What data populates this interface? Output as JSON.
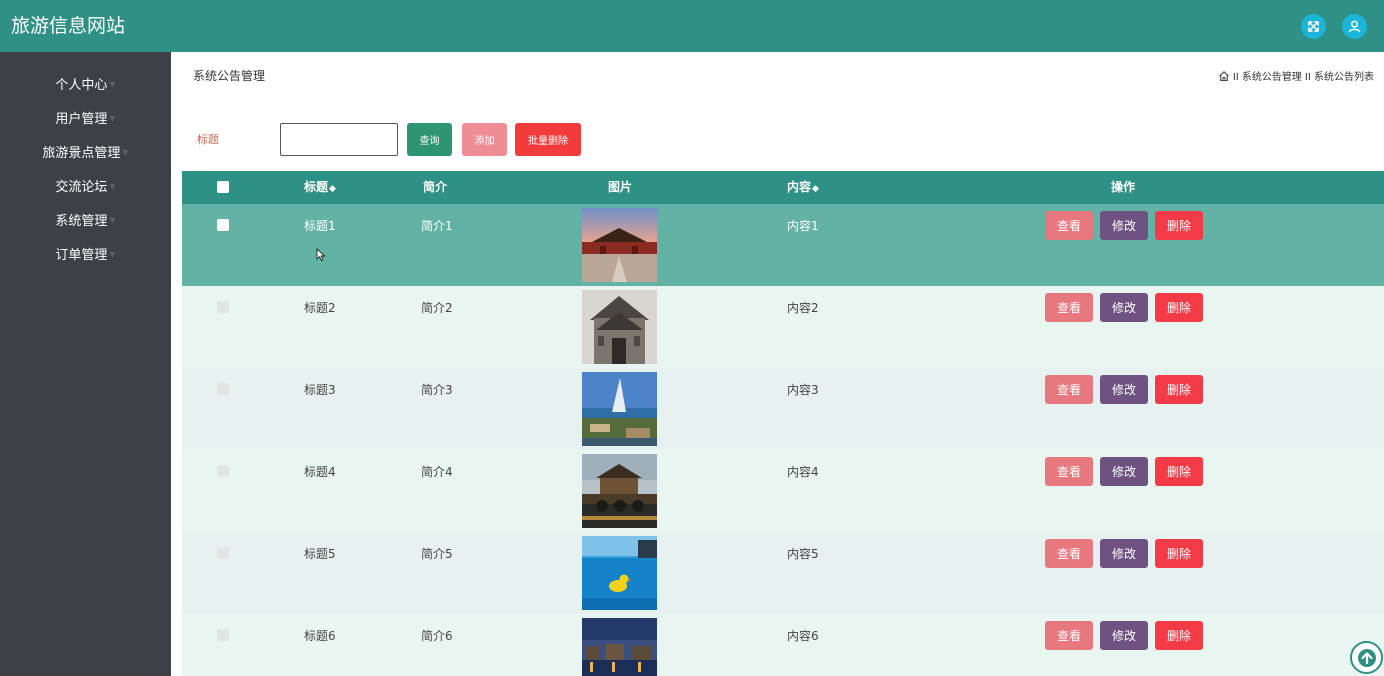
{
  "header": {
    "site_title": "旅游信息网站",
    "icons": [
      "fullscreen-icon",
      "user-icon"
    ]
  },
  "sidebar": {
    "items": [
      {
        "label": "个人中心"
      },
      {
        "label": "用户管理"
      },
      {
        "label": "旅游景点管理"
      },
      {
        "label": "交流论坛"
      },
      {
        "label": "系统管理"
      },
      {
        "label": "订单管理"
      }
    ]
  },
  "page": {
    "heading": "系统公告管理",
    "breadcrumb": [
      "II 系统公告管理",
      "II 系统公告列表"
    ]
  },
  "search": {
    "label": "标题",
    "value": "",
    "query_label": "查询",
    "add_label": "添加",
    "batch_delete_label": "批量删除"
  },
  "table": {
    "columns": {
      "title": "标题",
      "intro": "简介",
      "image": "图片",
      "content": "内容",
      "actions": "操作"
    },
    "sort_symbol": "◆",
    "action_labels": {
      "view": "查看",
      "edit": "修改",
      "delete": "删除"
    },
    "rows": [
      {
        "title": "标题1",
        "intro": "简介1",
        "content": "内容1",
        "image": "palace-photo",
        "selected": true
      },
      {
        "title": "标题2",
        "intro": "简介2",
        "content": "内容2",
        "image": "old-building-photo",
        "selected": false
      },
      {
        "title": "标题3",
        "intro": "简介3",
        "content": "内容3",
        "image": "coastal-hotel-photo",
        "selected": false
      },
      {
        "title": "标题4",
        "intro": "简介4",
        "content": "内容4",
        "image": "pavilion-bridge-photo",
        "selected": false
      },
      {
        "title": "标题5",
        "intro": "简介5",
        "content": "内容5",
        "image": "pool-duck-photo",
        "selected": false
      },
      {
        "title": "标题6",
        "intro": "简介6",
        "content": "内容6",
        "image": "night-town-photo",
        "selected": false
      }
    ]
  },
  "colors": {
    "header_bg": "#2f9185",
    "sidebar_bg": "#3e4046",
    "selected_row": "#62b3a6",
    "view_button": "#e7787f",
    "edit_button": "#6e5382",
    "delete_button": "#f23b47"
  }
}
